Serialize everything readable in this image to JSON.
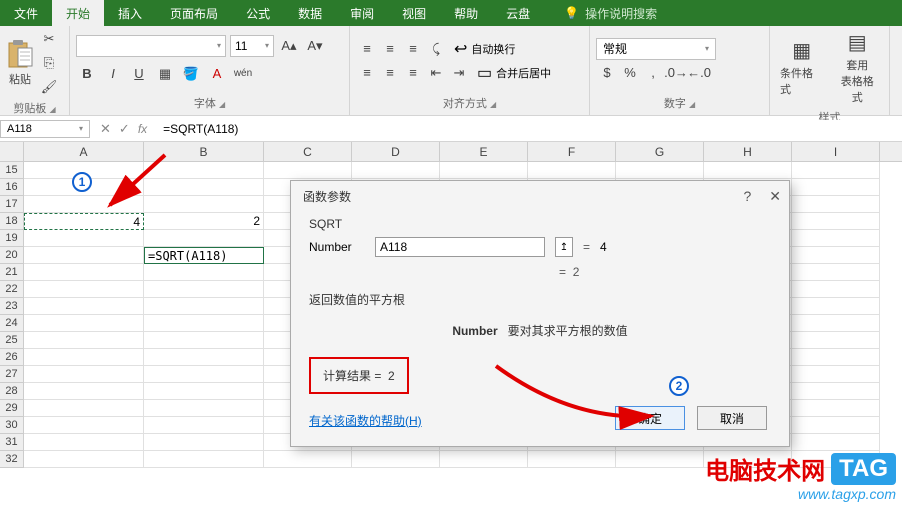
{
  "tabs": {
    "file": "文件",
    "home": "开始",
    "insert": "插入",
    "layout": "页面布局",
    "formulas": "公式",
    "data": "数据",
    "review": "审阅",
    "view": "视图",
    "help": "帮助",
    "cloud": "云盘",
    "tell_me": "操作说明搜索"
  },
  "ribbon": {
    "paste": "粘贴",
    "clipboard": "剪贴板",
    "font_size": "11",
    "font_group": "字体",
    "bold": "B",
    "italic": "I",
    "underline": "U",
    "ruby": "wén",
    "wrap_text": "自动换行",
    "merge": "合并后居中",
    "alignment": "对齐方式",
    "number_format": "常规",
    "number_group": "数字",
    "cond_fmt": "条件格式",
    "table_fmt": "套用\n表格格式",
    "styles_group": "样式"
  },
  "formula_bar": {
    "name_box": "A118",
    "formula": "=SQRT(A118)"
  },
  "grid": {
    "columns": [
      "A",
      "B",
      "C",
      "D",
      "E",
      "F",
      "G",
      "H",
      "I"
    ],
    "first_row": 15,
    "last_row": 32,
    "cells": {
      "A18": "4",
      "B18": "2",
      "B20": "=SQRT(A118)"
    }
  },
  "dialog": {
    "title": "函数参数",
    "fn": "SQRT",
    "arg_label": "Number",
    "arg_value": "A118",
    "arg_resolved": "4",
    "preview_eq": "=",
    "preview_value": "2",
    "desc": "返回数值的平方根",
    "arg_desc_label": "Number",
    "arg_desc_text": "要对其求平方根的数值",
    "calc_result_label": "计算结果 =",
    "calc_result_value": "2",
    "help_link": "有关该函数的帮助(H)",
    "ok": "确定",
    "cancel": "取消"
  },
  "annotations": {
    "n1": "1",
    "n2": "2"
  },
  "watermark": {
    "text": "电脑技术网",
    "tag": "TAG",
    "url": "www.tagxp.com"
  }
}
